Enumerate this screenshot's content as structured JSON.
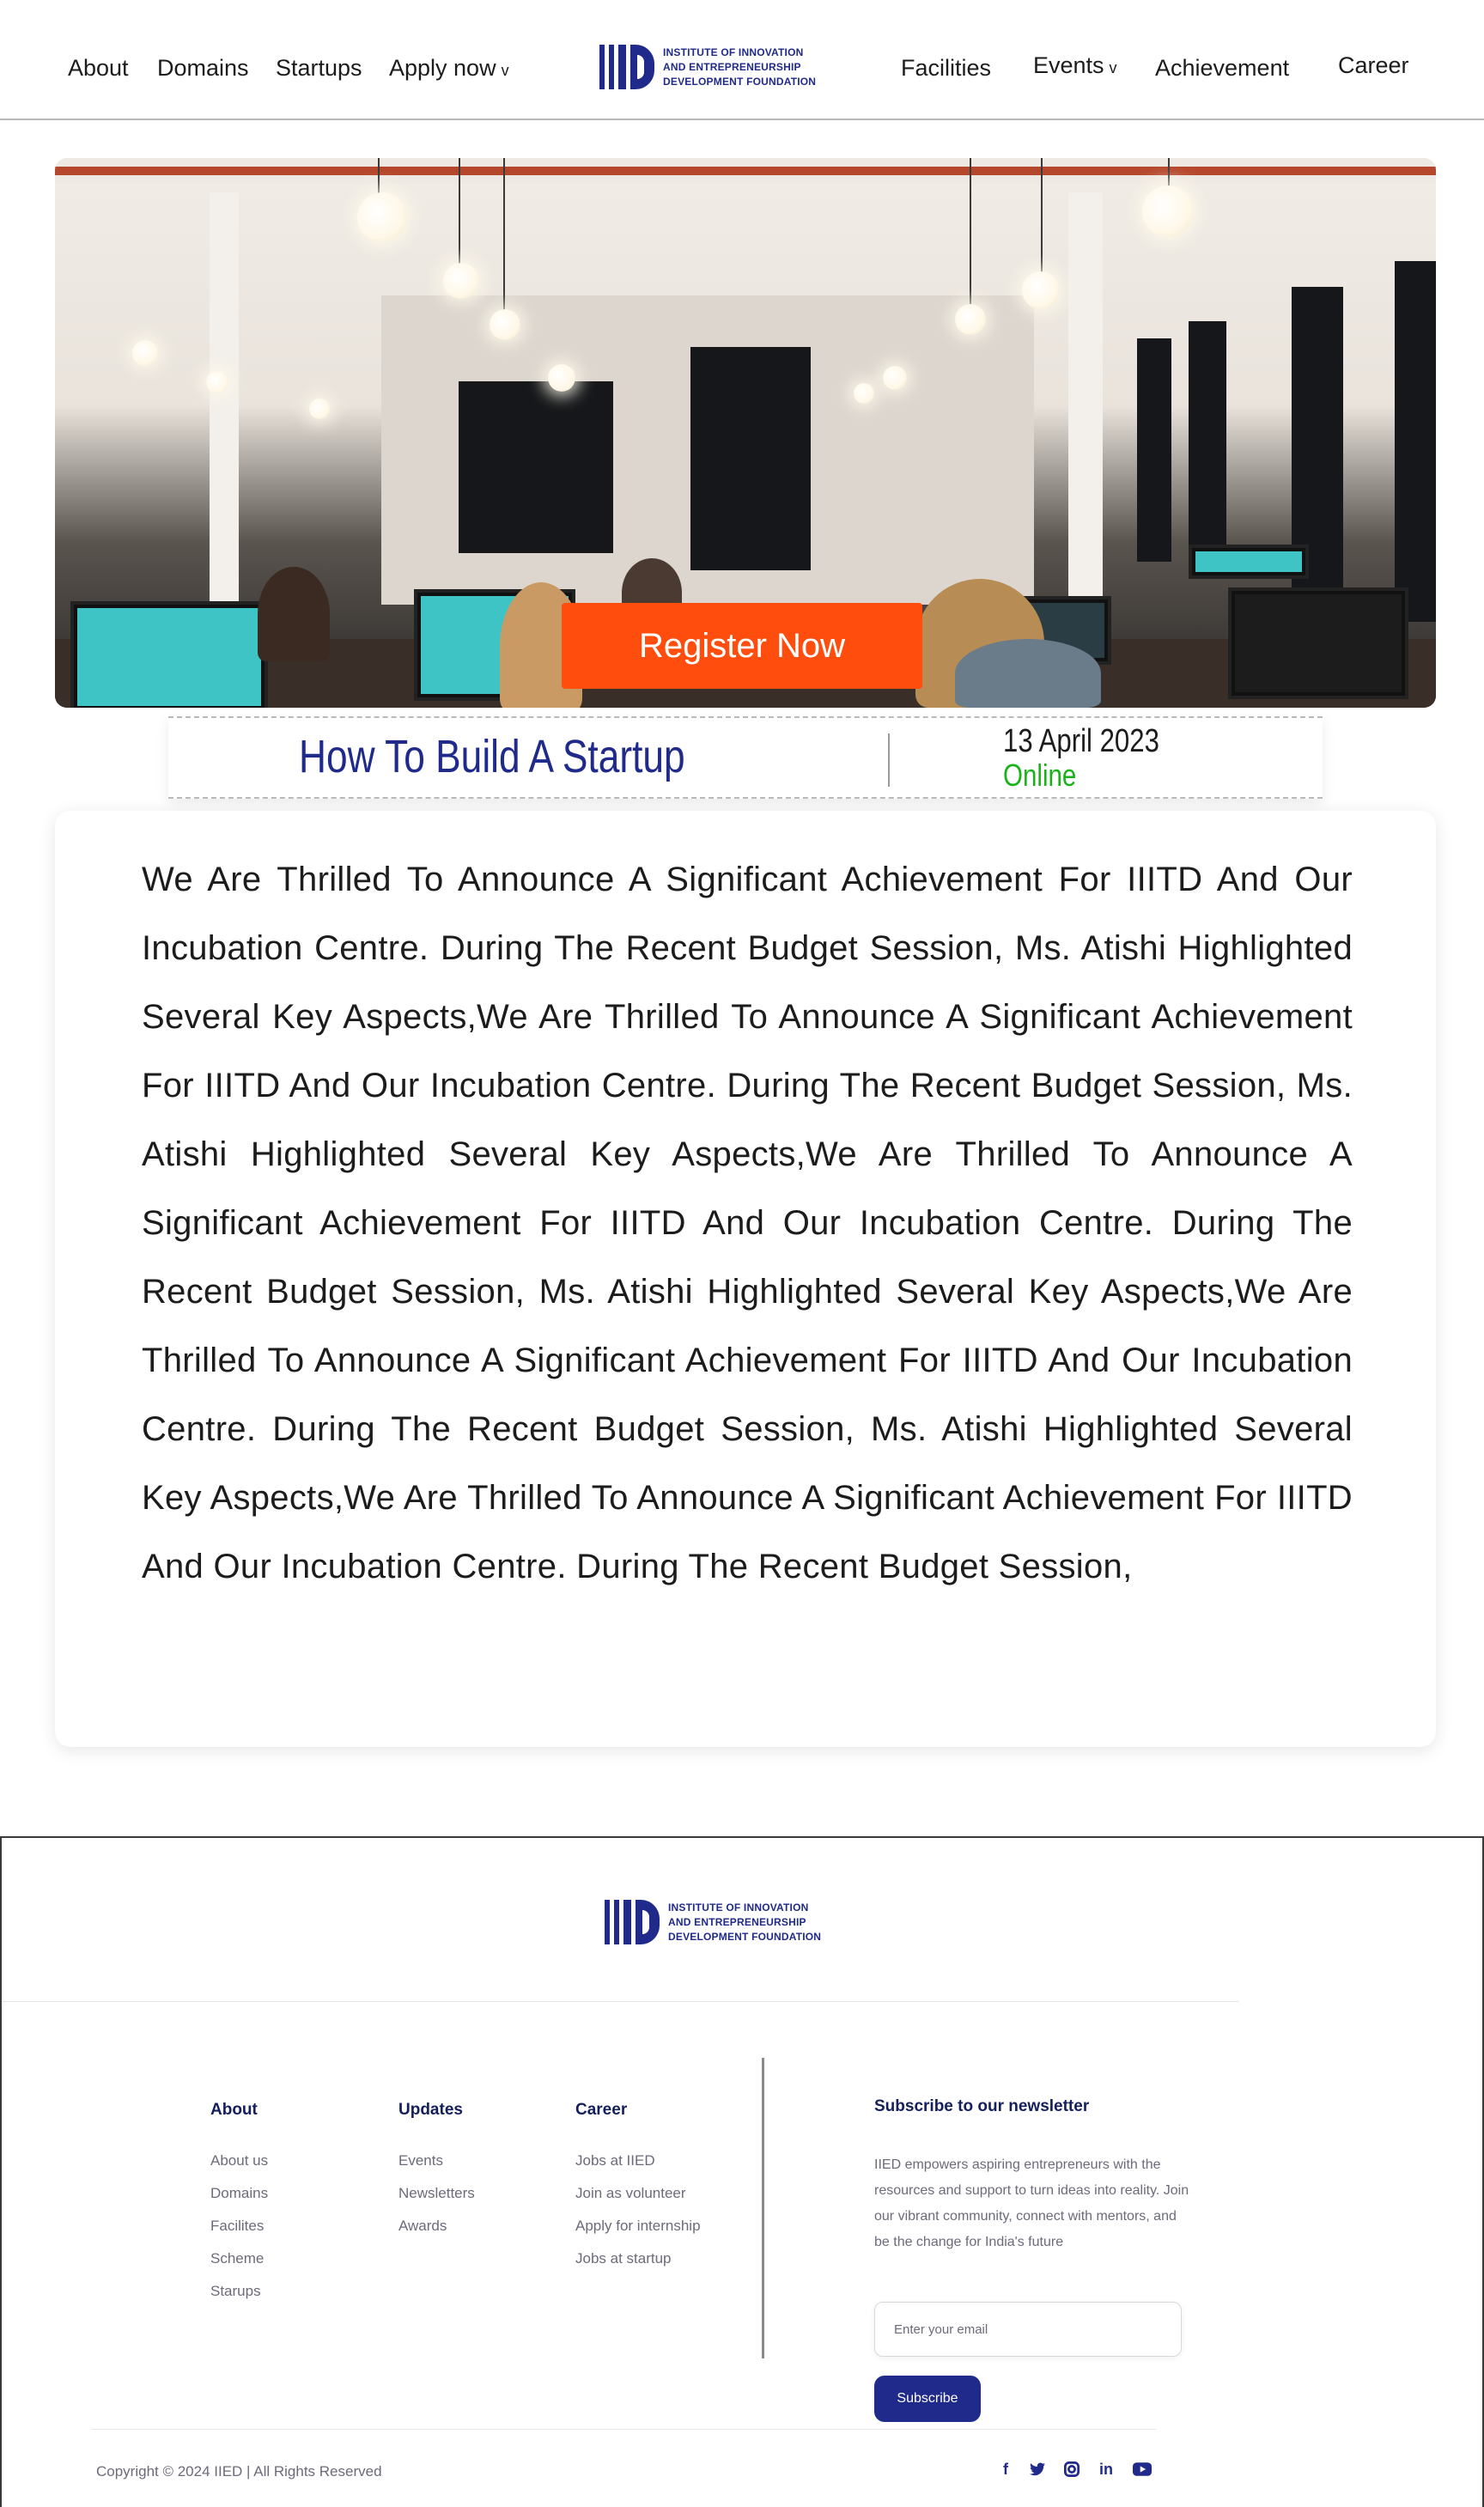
{
  "header": {
    "nav_left": [
      "About",
      "Domains",
      "Startups",
      "Apply now"
    ],
    "nav_right": [
      "Facilities",
      "Events",
      "Achievement",
      "Career"
    ],
    "caret": "v",
    "logo_text": [
      "INSTITUTE OF INNOVATION",
      "AND ENTREPRENEURSHIP",
      "DEVELOPMENT FOUNDATION"
    ]
  },
  "hero": {
    "register_label": "Register Now"
  },
  "event": {
    "title": "How To Build A Startup",
    "date": "13 April 2023",
    "mode": "Online"
  },
  "content": {
    "body": "We Are Thrilled To Announce A Significant Achievement For IIITD And Our Incubation Centre. During The Recent Budget Session, Ms. Atishi Highlighted Several Key Aspects,We Are Thrilled To Announce A Significant Achievement For IIITD And Our Incubation Centre. During The Recent Budget Session, Ms. Atishi Highlighted Several Key Aspects,We Are Thrilled To Announce A Significant Achievement For IIITD And Our Incubation Centre. During The Recent Budget Session, Ms. Atishi Highlighted Several Key Aspects,We Are Thrilled To Announce A Significant Achievement For IIITD And Our Incubation Centre. During The Recent Budget Session, Ms. Atishi Highlighted Several Key Aspects,We Are Thrilled To Announce A Significant Achievement For IIITD And Our Incubation Centre. During The Recent Budget Session,"
  },
  "footer": {
    "logo_text": [
      "INSTITUTE OF INNOVATION",
      "AND ENTREPRENEURSHIP",
      "DEVELOPMENT FOUNDATION"
    ],
    "columns": [
      {
        "heading": "About",
        "links": [
          "About us",
          "Domains",
          "Facilites",
          "Scheme",
          "Starups"
        ]
      },
      {
        "heading": "Updates",
        "links": [
          "Events",
          "Newsletters",
          "Awards"
        ]
      },
      {
        "heading": "Career",
        "links": [
          "Jobs at IIED",
          "Join as volunteer",
          "Apply for internship",
          "Jobs at startup"
        ]
      }
    ],
    "newsletter": {
      "heading": "Subscribe to our newsletter",
      "description": "IIED empowers aspiring entrepreneurs with the resources and support to turn ideas into reality. Join our vibrant community, connect with mentors, and be the change for India's future",
      "email_placeholder": "Enter your email",
      "subscribe_label": "Subscribe"
    },
    "copyright": "Copyright © 2024 IIED  | All Rights Reserved",
    "social_icons": [
      "facebook-icon",
      "twitter-icon",
      "instagram-icon",
      "linkedin-icon",
      "youtube-icon"
    ]
  },
  "colors": {
    "brand_navy": "#1f2a8a",
    "cta_orange": "#ff4d0d",
    "online_green": "#19b319"
  }
}
